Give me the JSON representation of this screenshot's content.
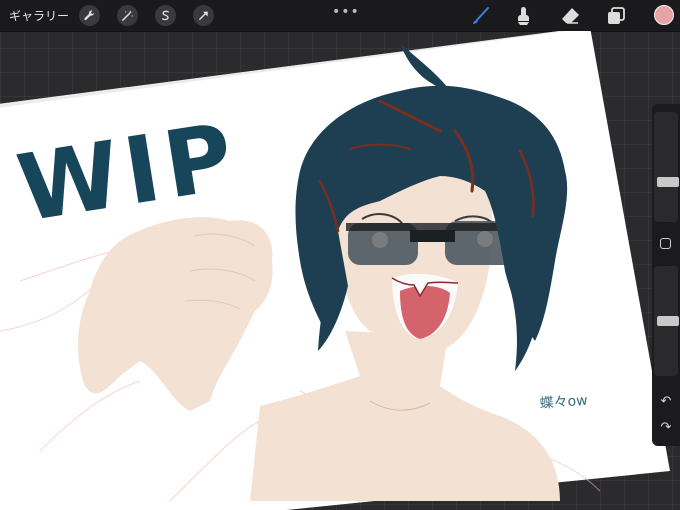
{
  "toolbar": {
    "gallery_label": "ギャラリー",
    "left_tools": [
      {
        "name": "actions-wrench-icon"
      },
      {
        "name": "adjustments-wand-icon"
      },
      {
        "name": "selection-s-icon"
      },
      {
        "name": "transform-arrow-icon"
      }
    ],
    "more_label": "•••",
    "right_tools": [
      {
        "name": "brush-icon",
        "active": true
      },
      {
        "name": "smudge-icon"
      },
      {
        "name": "eraser-icon"
      },
      {
        "name": "layers-icon"
      }
    ],
    "current_color": "#e7a3a6",
    "active_tool_color": "#3d7fe0"
  },
  "canvas": {
    "wip_text": "WIP",
    "wip_color": "#17455a",
    "signature_text": "蝶々ow",
    "hair_color": "#1e3f52",
    "hair_highlight": "#7a2f1e",
    "skin_color": "#f3e1d4",
    "tongue_color": "#d5636b",
    "lens_color": "#4c5960"
  },
  "sidebar": {
    "brush_size_label": "brush-size",
    "opacity_label": "opacity",
    "brush_size_level": 0.35,
    "opacity_level": 0.5,
    "undo_glyph": "↶",
    "redo_glyph": "↷"
  }
}
